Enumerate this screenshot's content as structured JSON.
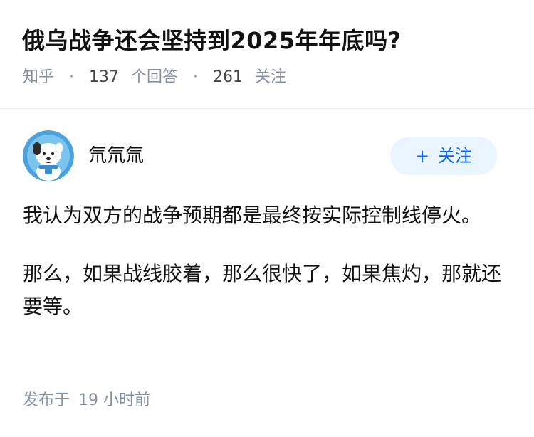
{
  "question": {
    "title": "俄乌战争还会坚持到2025年年底吗?",
    "source": "知乎",
    "answer_count": "137",
    "answer_label": "个回答",
    "follower_count": "261",
    "follower_label": "关注"
  },
  "answer": {
    "author_name": "氘氘氚",
    "follow_button_label": "关注",
    "paragraphs": [
      "我认为双方的战争预期都是最终按实际控制线停火。",
      "那么，如果战线胶着，那么很快了，如果焦灼，那就还要等。"
    ],
    "published_label": "发布于",
    "published_time": "19 小时前"
  },
  "colors": {
    "accent": "#0066ff",
    "follow_bg": "#ebf5ff",
    "meta_text": "#8590a6",
    "avatar_bg": "#4aa3df"
  },
  "icons": {
    "avatar": "cartoon-dog-avatar",
    "follow": "plus-icon"
  }
}
